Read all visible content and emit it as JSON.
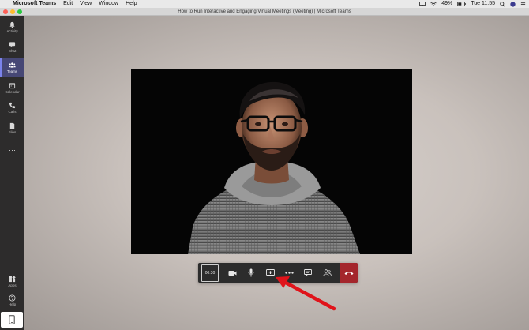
{
  "menubar": {
    "app_name": "Microsoft Teams",
    "menus": [
      "Edit",
      "View",
      "Window",
      "Help"
    ],
    "battery": "49%",
    "clock": "Tue 11:55"
  },
  "window": {
    "title": "How to Run Interactive and Engaging Virtual Meetings (Meeting) | Microsoft Teams"
  },
  "rail": {
    "items": [
      {
        "label": "Activity",
        "icon": "bell-icon"
      },
      {
        "label": "Chat",
        "icon": "chat-icon"
      },
      {
        "label": "Teams",
        "icon": "teams-icon",
        "active": true
      },
      {
        "label": "Calendar",
        "icon": "calendar-icon"
      },
      {
        "label": "Calls",
        "icon": "phone-icon"
      },
      {
        "label": "Files",
        "icon": "file-icon"
      }
    ],
    "more": "···",
    "bottom": [
      {
        "label": "Apps",
        "icon": "apps-icon"
      },
      {
        "label": "Help",
        "icon": "help-icon"
      }
    ]
  },
  "call": {
    "timer": "00:30"
  },
  "colors": {
    "rail_bg": "#2d2c2c",
    "rail_active": "#464775",
    "toolbar_bg": "#2c2c2c",
    "hangup": "#a4262c",
    "arrow": "#e0131a"
  }
}
